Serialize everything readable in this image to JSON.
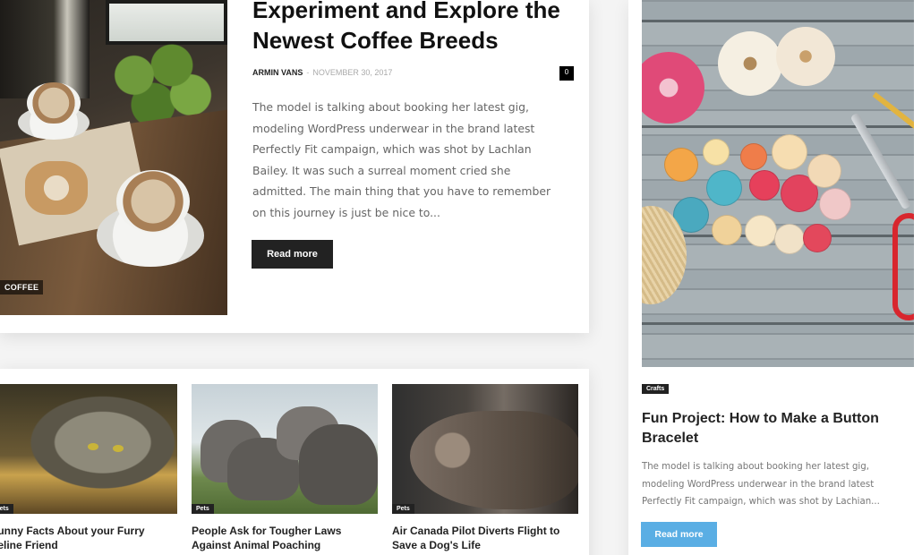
{
  "featured": {
    "category": "COFFEE",
    "title": "Experiment and Explore the Newest Coffee Breeds",
    "author": "ARMIN VANS",
    "separator": "-",
    "date": "NOVEMBER 30, 2017",
    "comments": "0",
    "excerpt": "The model is talking about booking her latest gig, modeling WordPress underwear in the brand latest Perfectly Fit campaign, which was shot by Lachlan Bailey. It was such a surreal moment cried she admitted. The main thing that you have to remember on this journey is just be nice to...",
    "read_more": "Read more"
  },
  "posts": [
    {
      "category": "Pets",
      "title": "Funny Facts About your Furry Feline Friend"
    },
    {
      "category": "Pets",
      "title": "People Ask for Tougher Laws Against Animal Poaching"
    },
    {
      "category": "Pets",
      "title": "Air Canada Pilot Diverts Flight to Save a Dog's Life"
    }
  ],
  "side": {
    "category": "Crafts",
    "title": "Fun Project: How to Make a Button Bracelet",
    "excerpt": "The model is talking about booking her latest gig, modeling WordPress underwear in the brand latest Perfectly Fit campaign, which was shot by Lachian...",
    "read_more": "Read more"
  },
  "colors": {
    "accent_blue": "#5aaee4",
    "dark_button": "#222222",
    "body_text": "#666666"
  }
}
